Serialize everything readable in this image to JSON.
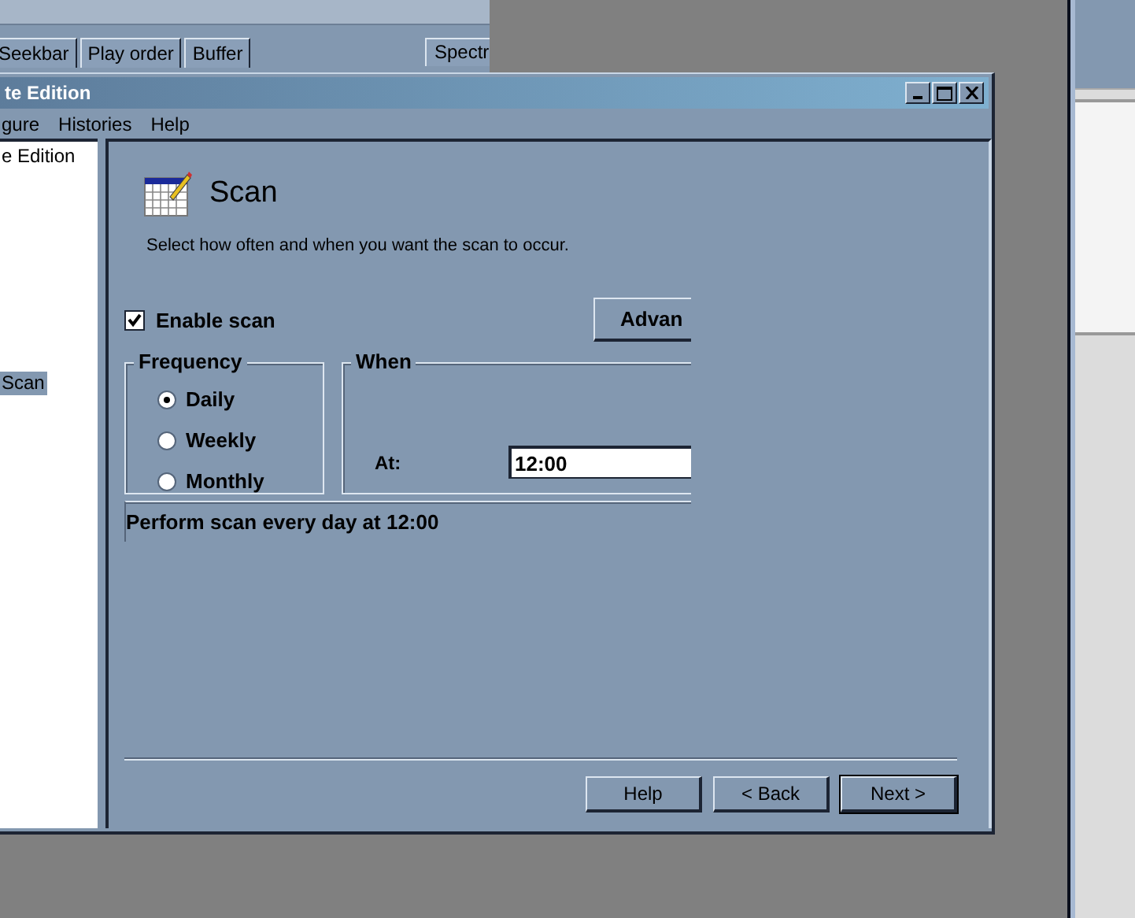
{
  "back_window": {
    "tabs": [
      {
        "label": "Seekbar",
        "selected": false
      },
      {
        "label": "Play order",
        "selected": false
      },
      {
        "label": "Buffer",
        "selected": false
      }
    ],
    "side_tab": {
      "label": "Spectr"
    }
  },
  "dialog": {
    "title": "te Edition",
    "menu": [
      "gure",
      "Histories",
      "Help"
    ],
    "tree": [
      {
        "label": "e Edition",
        "selected": false
      },
      {
        "label": "Scan",
        "selected": true
      }
    ],
    "page": {
      "title": "Scan",
      "description": "Select how often and when you want the scan to occur.",
      "enable_scan": {
        "label": "Enable scan",
        "checked": true
      },
      "advanced_button": "Advan",
      "frequency": {
        "title": "Frequency",
        "options": [
          {
            "label": "Daily",
            "selected": true
          },
          {
            "label": "Weekly",
            "selected": false
          },
          {
            "label": "Monthly",
            "selected": false
          }
        ]
      },
      "when": {
        "title": "When",
        "at_label": "At:",
        "time": "12:00"
      },
      "summary": "Perform scan every day at 12:00"
    },
    "buttons": [
      "Help",
      "< Back",
      "Next >"
    ]
  }
}
